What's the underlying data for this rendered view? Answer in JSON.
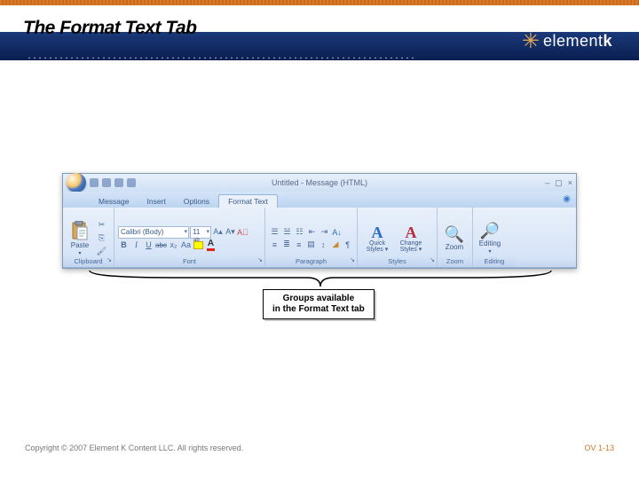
{
  "slide": {
    "title": "The Format Text Tab",
    "brand": "element",
    "brand_suffix": "k",
    "copyright": "Copyright © 2007 Element K Content LLC. All rights reserved.",
    "pagenum": "OV 1-13",
    "caption_l1": "Groups available",
    "caption_l2": "in the Format Text tab"
  },
  "window": {
    "title": "Untitled - Message (HTML)"
  },
  "tabs": {
    "t0": "Message",
    "t1": "Insert",
    "t2": "Options",
    "t3": "Format Text"
  },
  "groups": {
    "clipboard": "Clipboard",
    "font": "Font",
    "paragraph": "Paragraph",
    "styles": "Styles",
    "zoom": "Zoom",
    "editing": "Editing"
  },
  "clipboard": {
    "paste": "Paste"
  },
  "font": {
    "name": "Calibri (Body)",
    "size": "11",
    "bold": "B",
    "italic": "I",
    "underline": "U",
    "strike": "abc",
    "sub": "x₂",
    "sup": "Aa",
    "a": "A"
  },
  "styles": {
    "quick_l1": "Quick",
    "quick_l2": "Styles",
    "change_l1": "Change",
    "change_l2": "Styles"
  },
  "zoom": {
    "label": "Zoom"
  },
  "editing": {
    "label": "Editing"
  }
}
